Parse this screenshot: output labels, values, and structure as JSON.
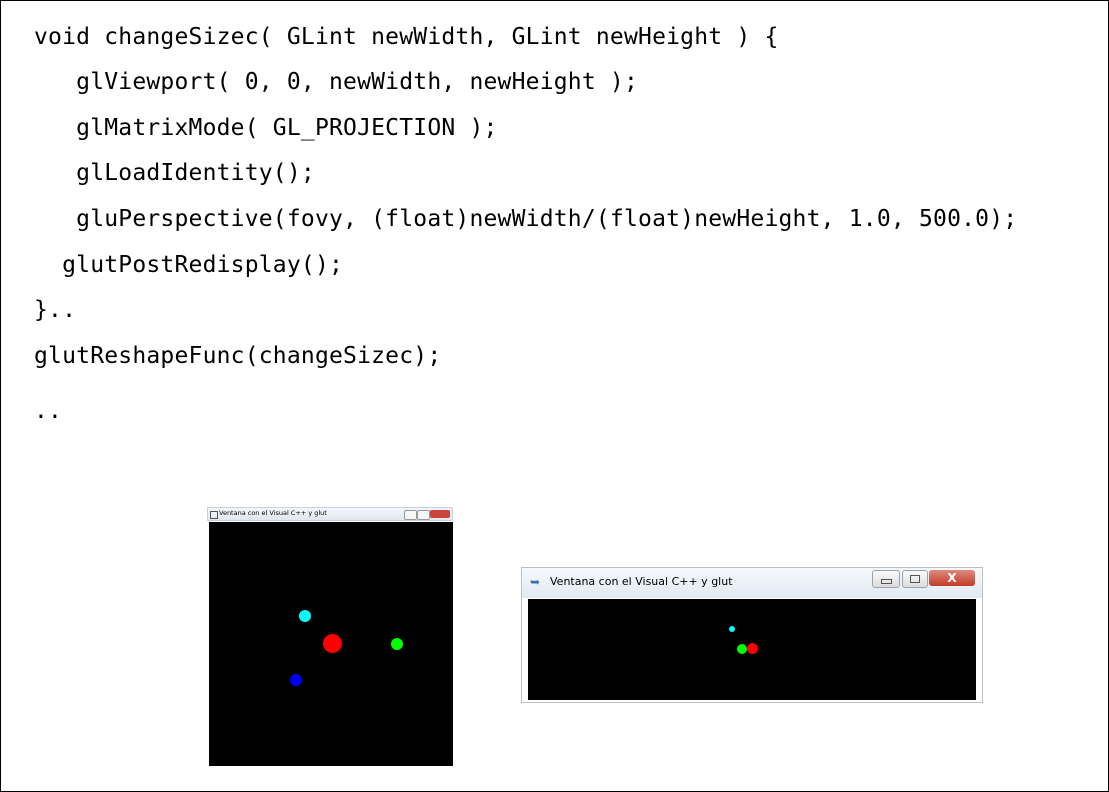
{
  "code": {
    "lines": [
      "void changeSizec( GLint newWidth, GLint newHeight ) {",
      "   glViewport( 0, 0, newWidth, newHeight );",
      "   glMatrixMode( GL_PROJECTION );",
      "   glLoadIdentity();",
      "   gluPerspective(fovy, (float)newWidth/(float)newHeight, 1.0, 500.0);",
      "  glutPostRedisplay();",
      "}..",
      "glutReshapeFunc(changeSizec);",
      ".."
    ]
  },
  "window_square": {
    "title": "Ventana con el Visual C++ y glut",
    "icon": "app-icon",
    "dots": [
      {
        "color": "#00ffff",
        "name": "cyan-point"
      },
      {
        "color": "#ff0000",
        "name": "red-point"
      },
      {
        "color": "#00ff00",
        "name": "green-point"
      },
      {
        "color": "#0000ff",
        "name": "blue-point"
      }
    ]
  },
  "window_wide": {
    "title": "Ventana con el Visual C++ y glut",
    "close_glyph": "X",
    "icon": "app-icon",
    "dots": [
      {
        "color": "#00ffff",
        "name": "cyan-point"
      },
      {
        "color": "#00ff00",
        "name": "green-point"
      },
      {
        "color": "#ff0000",
        "name": "red-point"
      }
    ]
  }
}
